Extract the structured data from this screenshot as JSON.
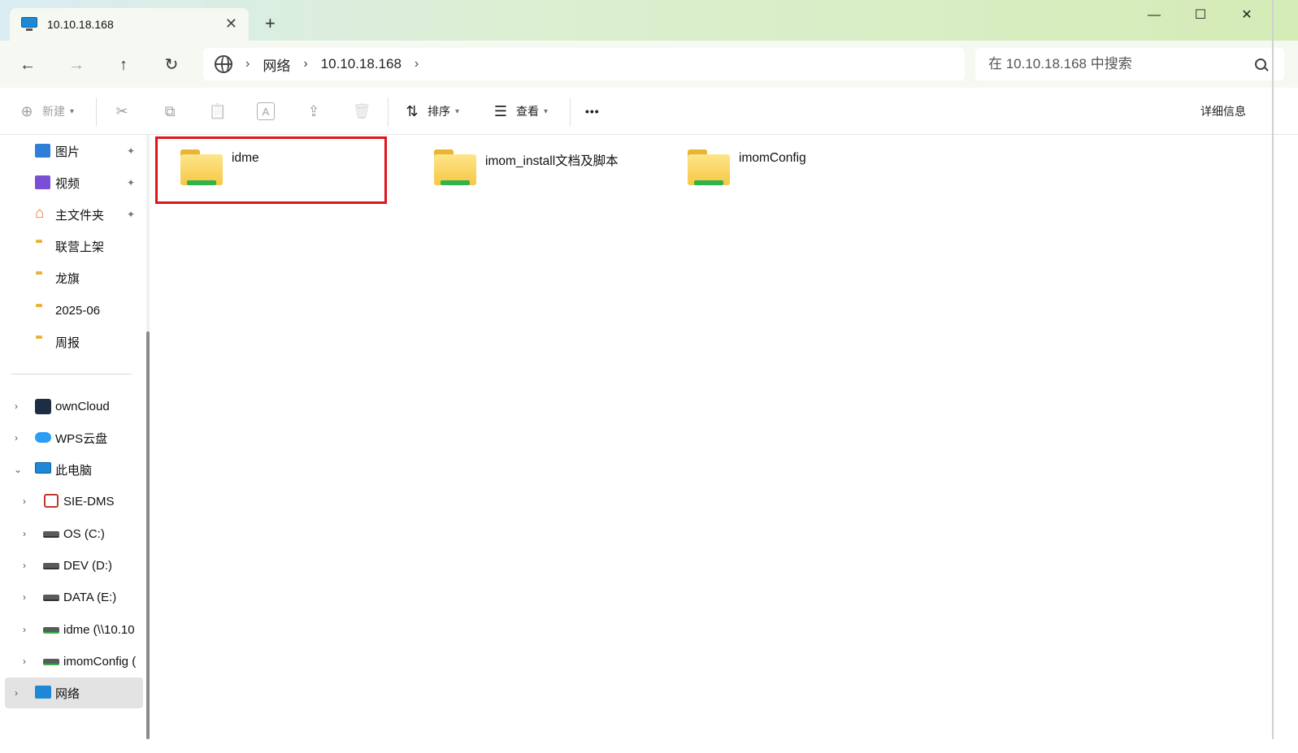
{
  "window": {
    "tab_title": "10.10.18.168",
    "tab_close": "✕",
    "new_tab": "+",
    "minimize": "—",
    "maximize": "☐",
    "close": "✕"
  },
  "nav": {
    "back": "←",
    "forward": "→",
    "up": "↑",
    "refresh": "↻",
    "breadcrumb": [
      "网络",
      "10.10.18.168"
    ],
    "chevron": "›",
    "search_placeholder": "在 10.10.18.168 中搜索"
  },
  "toolbar": {
    "new_label": "新建",
    "sort_label": "排序",
    "view_label": "查看",
    "more_label": "•••",
    "details_label": "详细信息",
    "icons": {
      "new": "⊕",
      "cut": "✂",
      "copy": "⧉",
      "paste": "📋",
      "rename": "A",
      "share": "⇪",
      "delete": "🗑",
      "sort": "⇅",
      "view": "☰"
    }
  },
  "sidebar": {
    "pinned": [
      {
        "label": "图片",
        "icon": "pictures-icon",
        "pinned": true
      },
      {
        "label": "视频",
        "icon": "videos-icon",
        "pinned": true
      },
      {
        "label": "主文件夹",
        "icon": "home-icon",
        "pinned": true
      },
      {
        "label": "联营上架",
        "icon": "folder-icon",
        "pinned": false
      },
      {
        "label": "龙旗",
        "icon": "folder-icon",
        "pinned": false
      },
      {
        "label": "2025-06",
        "icon": "folder-icon",
        "pinned": false
      },
      {
        "label": "周报",
        "icon": "folder-icon",
        "pinned": false
      }
    ],
    "tree": [
      {
        "label": "ownCloud",
        "icon": "owncloud-icon",
        "expand": "›"
      },
      {
        "label": "WPS云盘",
        "icon": "cloud-icon",
        "expand": "›"
      },
      {
        "label": "此电脑",
        "icon": "computer-icon",
        "expand": "⌄"
      },
      {
        "label": "SIE-DMS",
        "icon": "dms-icon",
        "expand": "›"
      },
      {
        "label": "OS (C:)",
        "icon": "os-drive-icon",
        "expand": "›"
      },
      {
        "label": "DEV (D:)",
        "icon": "drive-icon",
        "expand": "›"
      },
      {
        "label": "DATA (E:)",
        "icon": "drive-icon",
        "expand": "›"
      },
      {
        "label": "idme (\\\\10.10",
        "icon": "network-drive-icon",
        "expand": "›"
      },
      {
        "label": "imomConfig (",
        "icon": "network-drive-icon",
        "expand": "›"
      },
      {
        "label": "网络",
        "icon": "network-icon",
        "expand": "›"
      }
    ],
    "pin_glyph": "📌"
  },
  "content": {
    "items": [
      {
        "name": "idme",
        "type": "network-folder",
        "highlighted": true
      },
      {
        "name": "imom_install文档及脚本",
        "type": "network-folder",
        "highlighted": false
      },
      {
        "name": "imomConfig",
        "type": "network-folder",
        "highlighted": false
      }
    ]
  },
  "colors": {
    "accent": "#1e88d6",
    "highlight_border": "#e0141a",
    "selected_bg": "#e3e3e3",
    "folder_yellow": "#f7c948",
    "share_green": "#2fb34a"
  }
}
